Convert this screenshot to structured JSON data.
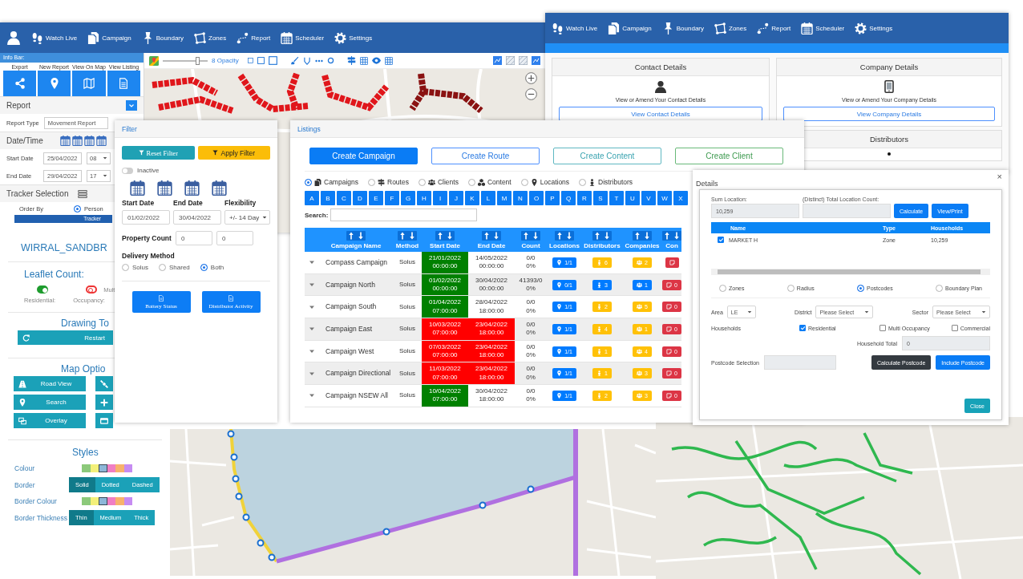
{
  "main_window": {
    "nav": [
      "Watch Live",
      "Campaign",
      "Boundary",
      "Zones",
      "Report",
      "Scheduler",
      "Settings"
    ],
    "info_bar": {
      "title": "Info Bar:",
      "actions": [
        "Export",
        "New Report",
        "View On Map",
        "View Listing"
      ]
    },
    "report": {
      "title": "Report",
      "type_label": "Report Type",
      "type_value": "Movement Report",
      "datetime_title": "Date/Time",
      "start_label": "Start Date",
      "start_date": "25/04/2022",
      "start_hour": "08",
      "end_label": "End Date",
      "end_date": "29/04/2022",
      "end_hour": "17",
      "tracker_title": "Tracker Selection",
      "order_label": "Order By",
      "order_options": [
        {
          "label": "Person",
          "selected": true
        }
      ],
      "tracker_tab": "Tracker"
    },
    "map_toolbar": {
      "opacity_label": "8 Opacity",
      "opacity": {
        "level": 0.8
      }
    }
  },
  "account_window": {
    "nav": [
      "Watch Live",
      "Campaign",
      "Boundary",
      "Zones",
      "Report",
      "Scheduler",
      "Settings"
    ],
    "contact": {
      "title": "Contact Details",
      "text": "View or Amend Your Contact Details",
      "button": "View Contact Details"
    },
    "company": {
      "title": "Company Details",
      "text": "View or Amend Your Company Details",
      "button": "View Company Details"
    },
    "distributors": {
      "title": "Distributors"
    }
  },
  "filter": {
    "title": "Filter",
    "reset": "Reset Filter",
    "apply": "Apply Filter",
    "inactive": {
      "label": "Inactive",
      "on": false
    },
    "labels": [
      "Start Date",
      "End Date",
      "Flexibility"
    ],
    "start": "01/02/2022",
    "end": "30/04/2022",
    "flexibility": "+/- 14 Day",
    "property_label": "Property Count",
    "property_min": "0",
    "property_max": "0",
    "delivery_label": "Delivery Method",
    "delivery": [
      {
        "label": "Solus",
        "selected": false
      },
      {
        "label": "Shared",
        "selected": false
      },
      {
        "label": "Both",
        "selected": true
      }
    ],
    "buttons": [
      "Battery Status",
      "Distributor Activity"
    ]
  },
  "listings": {
    "title": "Listings",
    "create": [
      {
        "label": "Create Campaign",
        "kind": "primary"
      },
      {
        "label": "Create Route",
        "kind": "outline-primary"
      },
      {
        "label": "Create Content",
        "kind": "outline-info"
      },
      {
        "label": "Create Client",
        "kind": "outline-success"
      }
    ],
    "types": [
      {
        "label": "Campaigns",
        "selected": true
      },
      {
        "label": "Routes",
        "selected": false
      },
      {
        "label": "Clients",
        "selected": false
      },
      {
        "label": "Content",
        "selected": false
      },
      {
        "label": "Locations",
        "selected": false
      },
      {
        "label": "Distributors",
        "selected": false
      }
    ],
    "letters": [
      "A",
      "B",
      "C",
      "D",
      "E",
      "F",
      "G",
      "H",
      "I",
      "J",
      "K",
      "L",
      "M",
      "N",
      "O",
      "P",
      "Q",
      "R",
      "S",
      "T",
      "U",
      "V",
      "W",
      "X"
    ],
    "search_label": "Search:",
    "columns": [
      "Campaign Name",
      "Method",
      "Start Date",
      "End Date",
      "Count",
      "Locations",
      "Distributors",
      "Companies",
      "Con"
    ],
    "rows": [
      {
        "name": "Compass Campaign",
        "method": "Solus",
        "start_date": "21/01/2022",
        "start_time": "00:00:00",
        "end_date": "14/05/2022",
        "end_time": "00:00:00",
        "expired": false,
        "count": "0/0",
        "percent": "0%",
        "locations": {
          "text": "1/1",
          "color": "#007bff"
        },
        "distributors": {
          "text": "6",
          "color": "#ffc107"
        },
        "companies": {
          "text": "2",
          "color": "#ffc107"
        },
        "content": {
          "color": "#dc3545"
        }
      },
      {
        "name": "Campaign North",
        "method": "Solus",
        "start_date": "01/02/2022",
        "start_time": "00:00:00",
        "end_date": "30/04/2022",
        "end_time": "00:00:00",
        "expired": false,
        "count": "41393/0",
        "percent": "0%",
        "locations": {
          "text": "0/1",
          "color": "#007bff"
        },
        "distributors": {
          "text": "3",
          "color": "#007bff"
        },
        "companies": {
          "text": "1",
          "color": "#007bff"
        },
        "content": {
          "text": "0",
          "color": "#dc3545"
        }
      },
      {
        "name": "Campaign South",
        "method": "Solus",
        "start_date": "01/04/2022",
        "start_time": "07:00:00",
        "end_date": "28/04/2022",
        "end_time": "18:00:00",
        "expired": false,
        "count": "0/0",
        "percent": "0%",
        "locations": {
          "text": "1/1",
          "color": "#007bff"
        },
        "distributors": {
          "text": "2",
          "color": "#ffc107"
        },
        "companies": {
          "text": "5",
          "color": "#ffc107"
        },
        "content": {
          "text": "0",
          "color": "#dc3545"
        }
      },
      {
        "name": "Campaign East",
        "method": "Solus",
        "start_date": "10/03/2022",
        "start_time": "07:00:00",
        "end_date": "23/04/2022",
        "end_time": "18:00:00",
        "expired": true,
        "count": "0/0",
        "percent": "0%",
        "locations": {
          "text": "1/1",
          "color": "#007bff"
        },
        "distributors": {
          "text": "4",
          "color": "#ffc107"
        },
        "companies": {
          "text": "1",
          "color": "#ffc107"
        },
        "content": {
          "text": "0",
          "color": "#dc3545"
        }
      },
      {
        "name": "Campaign West",
        "method": "Solus",
        "start_date": "07/03/2022",
        "start_time": "07:00:00",
        "end_date": "23/04/2022",
        "end_time": "18:00:00",
        "expired": true,
        "count": "0/0",
        "percent": "0%",
        "locations": {
          "text": "1/1",
          "color": "#007bff"
        },
        "distributors": {
          "text": "1",
          "color": "#ffc107"
        },
        "companies": {
          "text": "4",
          "color": "#ffc107"
        },
        "content": {
          "text": "0",
          "color": "#dc3545"
        }
      },
      {
        "name": "Campaign Directional",
        "method": "Solus",
        "start_date": "11/03/2022",
        "start_time": "07:00:00",
        "end_date": "23/04/2022",
        "end_time": "18:00:00",
        "expired": true,
        "count": "0/0",
        "percent": "0%",
        "locations": {
          "text": "1/1",
          "color": "#007bff"
        },
        "distributors": {
          "text": "1",
          "color": "#ffc107"
        },
        "companies": {
          "text": "3",
          "color": "#ffc107"
        },
        "content": {
          "text": "0",
          "color": "#dc3545"
        }
      },
      {
        "name": "Campaign NSEW All",
        "method": "Solus",
        "start_date": "10/04/2022",
        "start_time": "07:00:00",
        "end_date": "30/04/2022",
        "end_time": "18:00:00",
        "expired": false,
        "count": "0/0",
        "percent": "0%",
        "locations": {
          "text": "1/1",
          "color": "#007bff"
        },
        "distributors": {
          "text": "2",
          "color": "#ffc107"
        },
        "companies": {
          "text": "3",
          "color": "#ffc107"
        },
        "content": {
          "text": "0",
          "color": "#dc3545"
        }
      }
    ]
  },
  "details": {
    "title": "Details",
    "close_symbol": "×",
    "sum_label": "Sum Location:",
    "sum_value": "10,259",
    "total_label": "(Distinct) Total Location Count:",
    "calculate": "Calculate",
    "view_print": "View/Print",
    "columns": [
      "Name",
      "Type",
      "Households"
    ],
    "rows": [
      {
        "checked": true,
        "name": "MARKET H",
        "type": "Zone",
        "households": "10,259"
      }
    ],
    "modes": [
      {
        "label": "Zones",
        "selected": false
      },
      {
        "label": "Radius",
        "selected": false
      },
      {
        "label": "Postcodes",
        "selected": true
      },
      {
        "label": "Boundary Plan",
        "selected": false
      }
    ],
    "area_label": "Area",
    "area": "LE",
    "district_label": "District",
    "district": "Please Select",
    "sector_label": "Sector",
    "sector": "Please Select",
    "households_label": "Households",
    "property_types": [
      {
        "label": "Residential",
        "checked": true
      },
      {
        "label": "Multi Occupancy",
        "checked": false
      },
      {
        "label": "Commercial",
        "checked": false
      }
    ],
    "household_total_label": "Household Total",
    "household_total": "0",
    "postcode_label": "Postcode Selection",
    "calc_postcode": "Calculate Postcode",
    "include_postcode": "Include Postcode",
    "close": "Close"
  },
  "side_panel": {
    "title": "WIRRAL_SANDBR",
    "leaflet_title": "Leaflet Count:",
    "toggles": [
      {
        "label": "Residential:",
        "on": true
      },
      {
        "side_text": "Mult",
        "label": "Occupancy:",
        "on": false
      }
    ],
    "drawing_title": "Drawing To",
    "restart": "Restart",
    "map_options_title": "Map Optio",
    "map_buttons": [
      "Road View",
      "Search",
      "Overlay"
    ],
    "styles_title": "Styles",
    "colour_label": "Colour",
    "colours": [
      {
        "color": "#8cc97a",
        "selected": false
      },
      {
        "color": "#f3f07a",
        "selected": false
      },
      {
        "color": "#8db6d8",
        "selected": true
      },
      {
        "color": "#f07ec3",
        "selected": false
      },
      {
        "color": "#f7b26c",
        "selected": false
      },
      {
        "color": "#c68cf2",
        "selected": false
      }
    ],
    "border_label": "Border",
    "border_styles": [
      {
        "label": "Solid",
        "selected": true
      },
      {
        "label": "Dotted",
        "selected": false
      },
      {
        "label": "Dashed",
        "selected": false
      }
    ],
    "border_colour_label": "Border Colour",
    "border_colours": [
      {
        "color": "#8cc97a",
        "selected": false
      },
      {
        "color": "#f3f07a",
        "selected": false
      },
      {
        "color": "#8db6d8",
        "selected": true
      },
      {
        "color": "#f07ec3",
        "selected": false
      },
      {
        "color": "#f7b26c",
        "selected": false
      },
      {
        "color": "#c68cf2",
        "selected": false
      }
    ],
    "thickness_label": "Border Thickness",
    "thicknesses": [
      {
        "label": "Thin",
        "selected": true
      },
      {
        "label": "Medium",
        "selected": false
      },
      {
        "label": "Thick",
        "selected": false
      }
    ]
  }
}
